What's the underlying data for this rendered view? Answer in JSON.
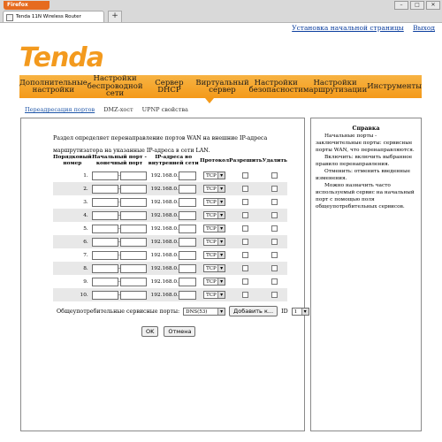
{
  "browser": {
    "firefox_label": "Firefox",
    "tab_title": "Tenda 11N Wireless Router",
    "new_tab": "+"
  },
  "top_links": {
    "home": "Установка начальной страницы",
    "exit": "Выход"
  },
  "logo": "Tenda",
  "nav": [
    "Дополнительные настройки",
    "Настройки беспроводной сети",
    "Сервер DHCP",
    "Виртуальный сервер",
    "Настройки безопасности",
    "Настройки маршрутизации",
    "Инструменты"
  ],
  "subnav": [
    "Переадресация портов",
    "DMZ-хост",
    "UPNP свойства"
  ],
  "intro": "Раздел определяет перенаправление портов WAN на внешние IP-адреса маршрутизатора на указанные IP-адреса в сети LAN.",
  "table": {
    "headers": [
      "Порядковый номер",
      "Начальный порт - конечный порт",
      "IP-адреса во внутренней сети",
      "Протокол",
      "Разрешить",
      "Удалить"
    ],
    "ip_prefix": "192.168.0.",
    "protocol": "TCP",
    "rows": [
      "1.",
      "2.",
      "3.",
      "4.",
      "5.",
      "6.",
      "7.",
      "8.",
      "9.",
      "10."
    ]
  },
  "common": {
    "label": "Общеупотребительные сервисные порты:",
    "service": "DNS(53)",
    "add_button": "Добавить к...",
    "id_label": "ID",
    "id_value": "1"
  },
  "buttons": {
    "ok": "OK",
    "cancel": "Отмена"
  },
  "help": {
    "title": "Справка",
    "paragraphs": [
      "Начальные порты - заключительные порты: сервисные порты WAN, что перенаправляются.",
      "Включить: включить выбранное правило перенаправления.",
      "Отменить: отменить введенные изменения.",
      "Можно назначить часто используемый сервис на начальный порт с помощью поля общеупотребительных сервисов."
    ]
  }
}
